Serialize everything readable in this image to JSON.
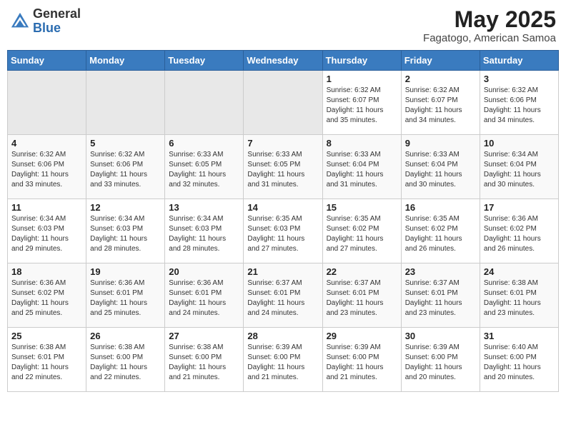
{
  "header": {
    "logo_general": "General",
    "logo_blue": "Blue",
    "month_title": "May 2025",
    "location": "Fagatogo, American Samoa"
  },
  "weekdays": [
    "Sunday",
    "Monday",
    "Tuesday",
    "Wednesday",
    "Thursday",
    "Friday",
    "Saturday"
  ],
  "weeks": [
    [
      {
        "day": null,
        "info": null
      },
      {
        "day": null,
        "info": null
      },
      {
        "day": null,
        "info": null
      },
      {
        "day": null,
        "info": null
      },
      {
        "day": "1",
        "info": "Sunrise: 6:32 AM\nSunset: 6:07 PM\nDaylight: 11 hours\nand 35 minutes."
      },
      {
        "day": "2",
        "info": "Sunrise: 6:32 AM\nSunset: 6:07 PM\nDaylight: 11 hours\nand 34 minutes."
      },
      {
        "day": "3",
        "info": "Sunrise: 6:32 AM\nSunset: 6:06 PM\nDaylight: 11 hours\nand 34 minutes."
      }
    ],
    [
      {
        "day": "4",
        "info": "Sunrise: 6:32 AM\nSunset: 6:06 PM\nDaylight: 11 hours\nand 33 minutes."
      },
      {
        "day": "5",
        "info": "Sunrise: 6:32 AM\nSunset: 6:06 PM\nDaylight: 11 hours\nand 33 minutes."
      },
      {
        "day": "6",
        "info": "Sunrise: 6:33 AM\nSunset: 6:05 PM\nDaylight: 11 hours\nand 32 minutes."
      },
      {
        "day": "7",
        "info": "Sunrise: 6:33 AM\nSunset: 6:05 PM\nDaylight: 11 hours\nand 31 minutes."
      },
      {
        "day": "8",
        "info": "Sunrise: 6:33 AM\nSunset: 6:04 PM\nDaylight: 11 hours\nand 31 minutes."
      },
      {
        "day": "9",
        "info": "Sunrise: 6:33 AM\nSunset: 6:04 PM\nDaylight: 11 hours\nand 30 minutes."
      },
      {
        "day": "10",
        "info": "Sunrise: 6:34 AM\nSunset: 6:04 PM\nDaylight: 11 hours\nand 30 minutes."
      }
    ],
    [
      {
        "day": "11",
        "info": "Sunrise: 6:34 AM\nSunset: 6:03 PM\nDaylight: 11 hours\nand 29 minutes."
      },
      {
        "day": "12",
        "info": "Sunrise: 6:34 AM\nSunset: 6:03 PM\nDaylight: 11 hours\nand 28 minutes."
      },
      {
        "day": "13",
        "info": "Sunrise: 6:34 AM\nSunset: 6:03 PM\nDaylight: 11 hours\nand 28 minutes."
      },
      {
        "day": "14",
        "info": "Sunrise: 6:35 AM\nSunset: 6:03 PM\nDaylight: 11 hours\nand 27 minutes."
      },
      {
        "day": "15",
        "info": "Sunrise: 6:35 AM\nSunset: 6:02 PM\nDaylight: 11 hours\nand 27 minutes."
      },
      {
        "day": "16",
        "info": "Sunrise: 6:35 AM\nSunset: 6:02 PM\nDaylight: 11 hours\nand 26 minutes."
      },
      {
        "day": "17",
        "info": "Sunrise: 6:36 AM\nSunset: 6:02 PM\nDaylight: 11 hours\nand 26 minutes."
      }
    ],
    [
      {
        "day": "18",
        "info": "Sunrise: 6:36 AM\nSunset: 6:02 PM\nDaylight: 11 hours\nand 25 minutes."
      },
      {
        "day": "19",
        "info": "Sunrise: 6:36 AM\nSunset: 6:01 PM\nDaylight: 11 hours\nand 25 minutes."
      },
      {
        "day": "20",
        "info": "Sunrise: 6:36 AM\nSunset: 6:01 PM\nDaylight: 11 hours\nand 24 minutes."
      },
      {
        "day": "21",
        "info": "Sunrise: 6:37 AM\nSunset: 6:01 PM\nDaylight: 11 hours\nand 24 minutes."
      },
      {
        "day": "22",
        "info": "Sunrise: 6:37 AM\nSunset: 6:01 PM\nDaylight: 11 hours\nand 23 minutes."
      },
      {
        "day": "23",
        "info": "Sunrise: 6:37 AM\nSunset: 6:01 PM\nDaylight: 11 hours\nand 23 minutes."
      },
      {
        "day": "24",
        "info": "Sunrise: 6:38 AM\nSunset: 6:01 PM\nDaylight: 11 hours\nand 23 minutes."
      }
    ],
    [
      {
        "day": "25",
        "info": "Sunrise: 6:38 AM\nSunset: 6:01 PM\nDaylight: 11 hours\nand 22 minutes."
      },
      {
        "day": "26",
        "info": "Sunrise: 6:38 AM\nSunset: 6:00 PM\nDaylight: 11 hours\nand 22 minutes."
      },
      {
        "day": "27",
        "info": "Sunrise: 6:38 AM\nSunset: 6:00 PM\nDaylight: 11 hours\nand 21 minutes."
      },
      {
        "day": "28",
        "info": "Sunrise: 6:39 AM\nSunset: 6:00 PM\nDaylight: 11 hours\nand 21 minutes."
      },
      {
        "day": "29",
        "info": "Sunrise: 6:39 AM\nSunset: 6:00 PM\nDaylight: 11 hours\nand 21 minutes."
      },
      {
        "day": "30",
        "info": "Sunrise: 6:39 AM\nSunset: 6:00 PM\nDaylight: 11 hours\nand 20 minutes."
      },
      {
        "day": "31",
        "info": "Sunrise: 6:40 AM\nSunset: 6:00 PM\nDaylight: 11 hours\nand 20 minutes."
      }
    ]
  ]
}
